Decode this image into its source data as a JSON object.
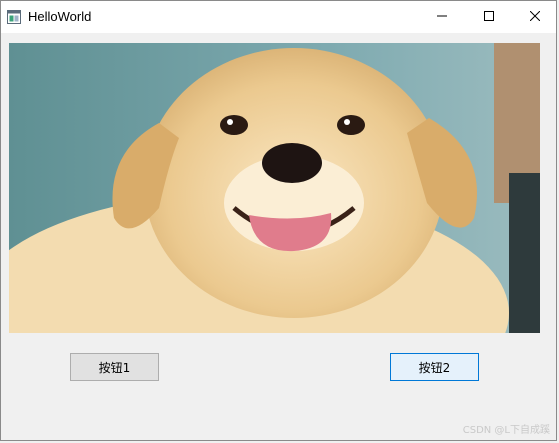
{
  "window": {
    "title": "HelloWorld",
    "app_icon": "app-window-icon",
    "controls": {
      "minimize": "minimize-icon",
      "maximize": "maximize-icon",
      "close": "close-icon"
    }
  },
  "image": {
    "subject": "puppy-photo"
  },
  "buttons": {
    "button1": "按钮1",
    "button2": "按钮2"
  },
  "watermark": "CSDN @L下自成蹊",
  "colors": {
    "titlebar": "#ffffff",
    "window_bg": "#f0f0f0",
    "focused_button_border": "#0078d7"
  }
}
